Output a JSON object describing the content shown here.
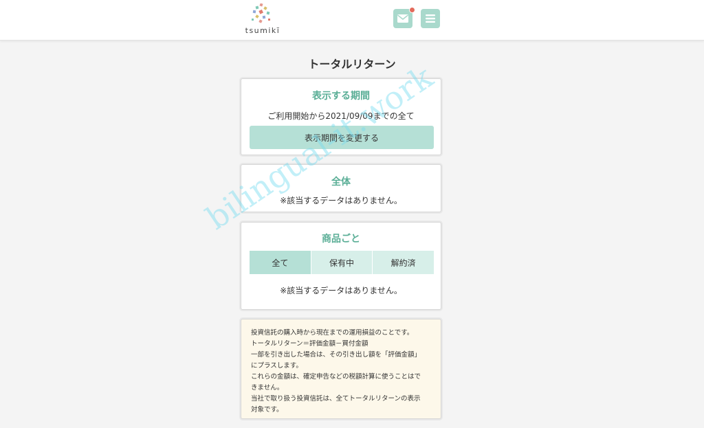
{
  "header": {
    "logo_text": "tsumikī",
    "mail_icon": "mail-icon",
    "menu_icon": "menu-icon",
    "notification_color": "#e36a5b"
  },
  "page": {
    "title": "トータルリターン"
  },
  "period": {
    "title": "表示する期間",
    "range_text": "ご利用開始から2021/09/09までの全て",
    "change_button": "表示期間を変更する"
  },
  "overall": {
    "title": "全体",
    "empty_text": "※該当するデータはありません。"
  },
  "products": {
    "title": "商品ごと",
    "tabs": [
      {
        "label": "全て",
        "active": true
      },
      {
        "label": "保有中",
        "active": false
      },
      {
        "label": "解約済",
        "active": false
      }
    ],
    "empty_text": "※該当するデータはありません。"
  },
  "note": {
    "lines": [
      "投資信託の購入時から現在までの運用損益のことです。",
      "トータルリターン＝評価金額－買付金額",
      "一部を引き出した場合は、その引き出し額を「評価金額」",
      "にプラスします。",
      "これらの金額は、確定申告などの税額計算に使うことはで",
      "きません。",
      "当社で取り扱う投資信託は、全てトータルリターンの表示",
      "対象です。"
    ]
  },
  "watermark": "bilingual-it.work",
  "colors": {
    "accent": "#5aae96",
    "button": "#b5e0d6",
    "tab": "#d7efe9",
    "note_bg": "#fdf8ea"
  }
}
